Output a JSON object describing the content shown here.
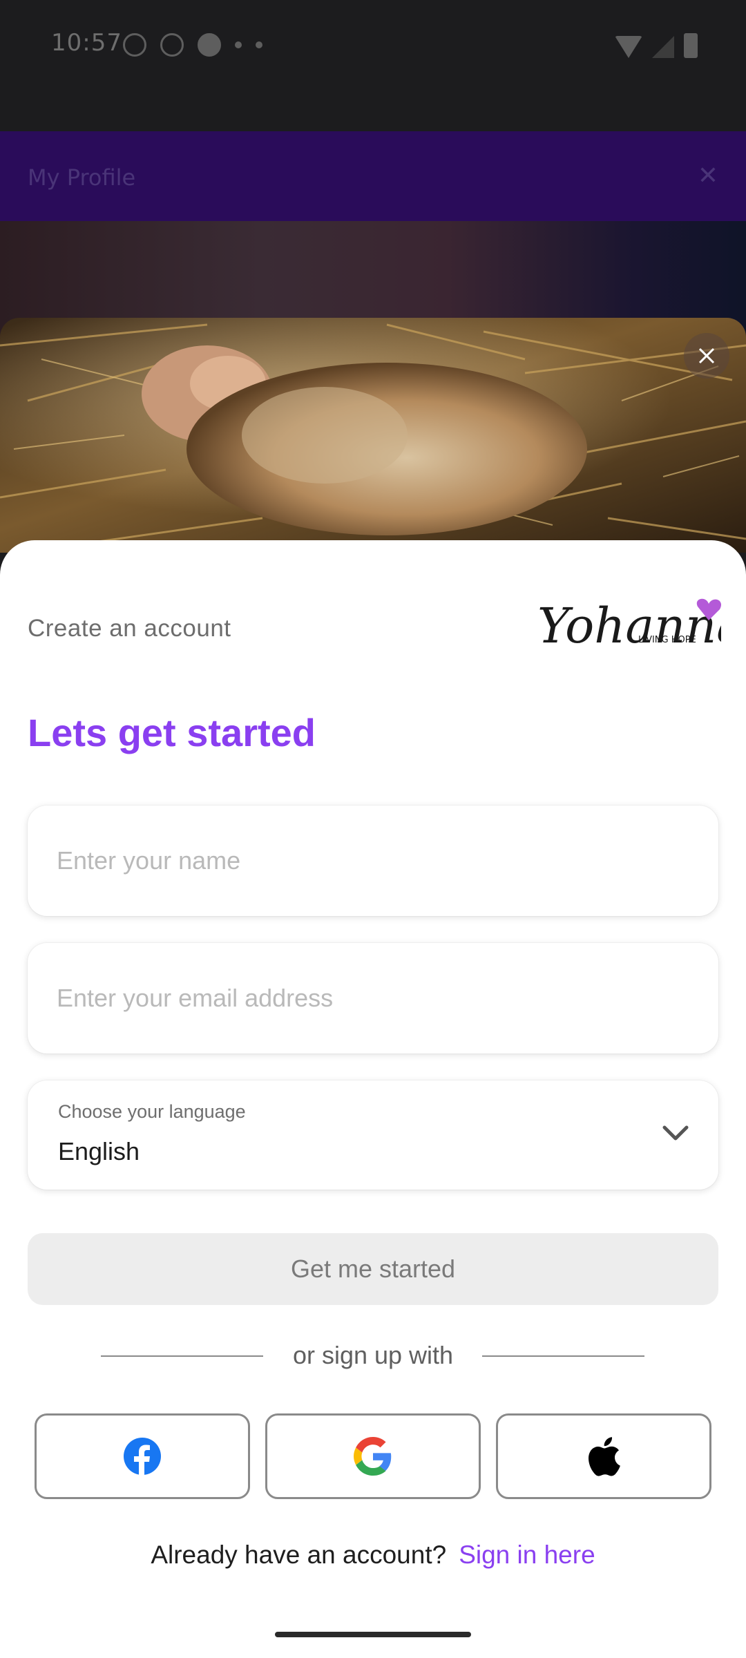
{
  "status_bar": {
    "time": "10:57"
  },
  "background_app": {
    "title": "My Profile"
  },
  "modal": {
    "create_label": "Create an account",
    "logo": {
      "wordmark": "Yohanna",
      "tagline": "LIVING HOPE"
    },
    "headline": "Lets get started",
    "name_field": {
      "placeholder": "Enter your name",
      "value": ""
    },
    "email_field": {
      "placeholder": "Enter your email address",
      "value": ""
    },
    "language": {
      "label": "Choose your language",
      "value": "English"
    },
    "cta_label": "Get me started",
    "divider_text": "or sign up with",
    "social": [
      {
        "name": "facebook-icon",
        "color": "#1877F2"
      },
      {
        "name": "google-icon"
      },
      {
        "name": "apple-icon",
        "color": "#000000"
      }
    ],
    "signin_question": "Already have an account?",
    "signin_link": "Sign in here"
  },
  "colors": {
    "accent": "#8A3FF0",
    "logo_heart": "#B45AD8"
  }
}
